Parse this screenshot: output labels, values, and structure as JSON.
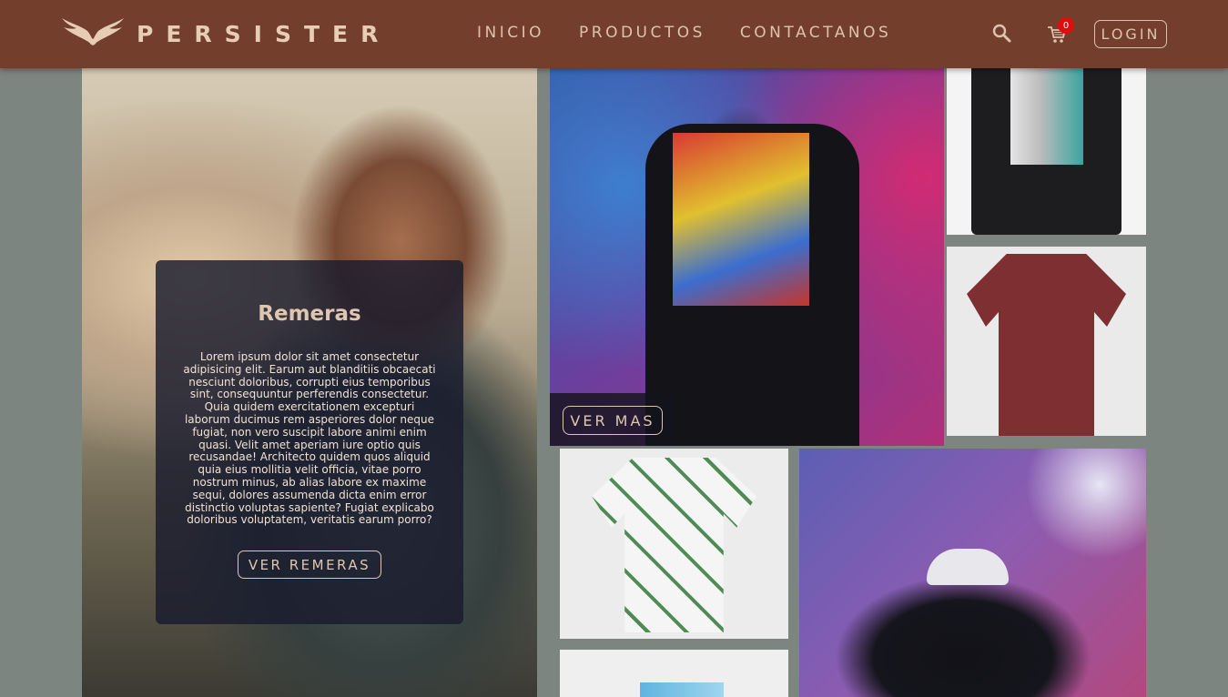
{
  "header": {
    "brand_name": "PERSISTER",
    "nav": [
      "INICIO",
      "PRODUCTOS",
      "CONTACTANOS"
    ],
    "cart_count": "0",
    "login_label": "LOGIN"
  },
  "hero": {
    "title": "Remeras",
    "text": "Lorem ipsum dolor sit amet consectetur adipisicing elit. Earum aut blanditiis obcaecati nesciunt doloribus, corrupti eius temporibus sint, consequuntur perferendis consectetur. Quia quidem exercitationem excepturi laborum ducimus rem asperiores dolor neque fugiat, non vero suscipit labore animi enim quasi. Velit amet aperiam iure optio quis recusandae! Architecto quidem quos aliquid quia eius mollitia velit officia, vitae porro nostrum minus, ab alias labore ex maxime sequi, dolores assumenda dicta enim error distinctio voluptas sapiente? Fugiat explicabo doloribus voluptatem, veritatis earum porro?",
    "button_label": "VER REMERAS"
  },
  "feature": {
    "button_label": "VER MAS"
  },
  "colors": {
    "navbar": "#733f2c",
    "accent": "#ddc3ad",
    "page_bg": "#7c857f",
    "badge": "#e00d0d"
  },
  "icons": [
    "wings-logo-icon",
    "search-icon",
    "cart-icon"
  ]
}
